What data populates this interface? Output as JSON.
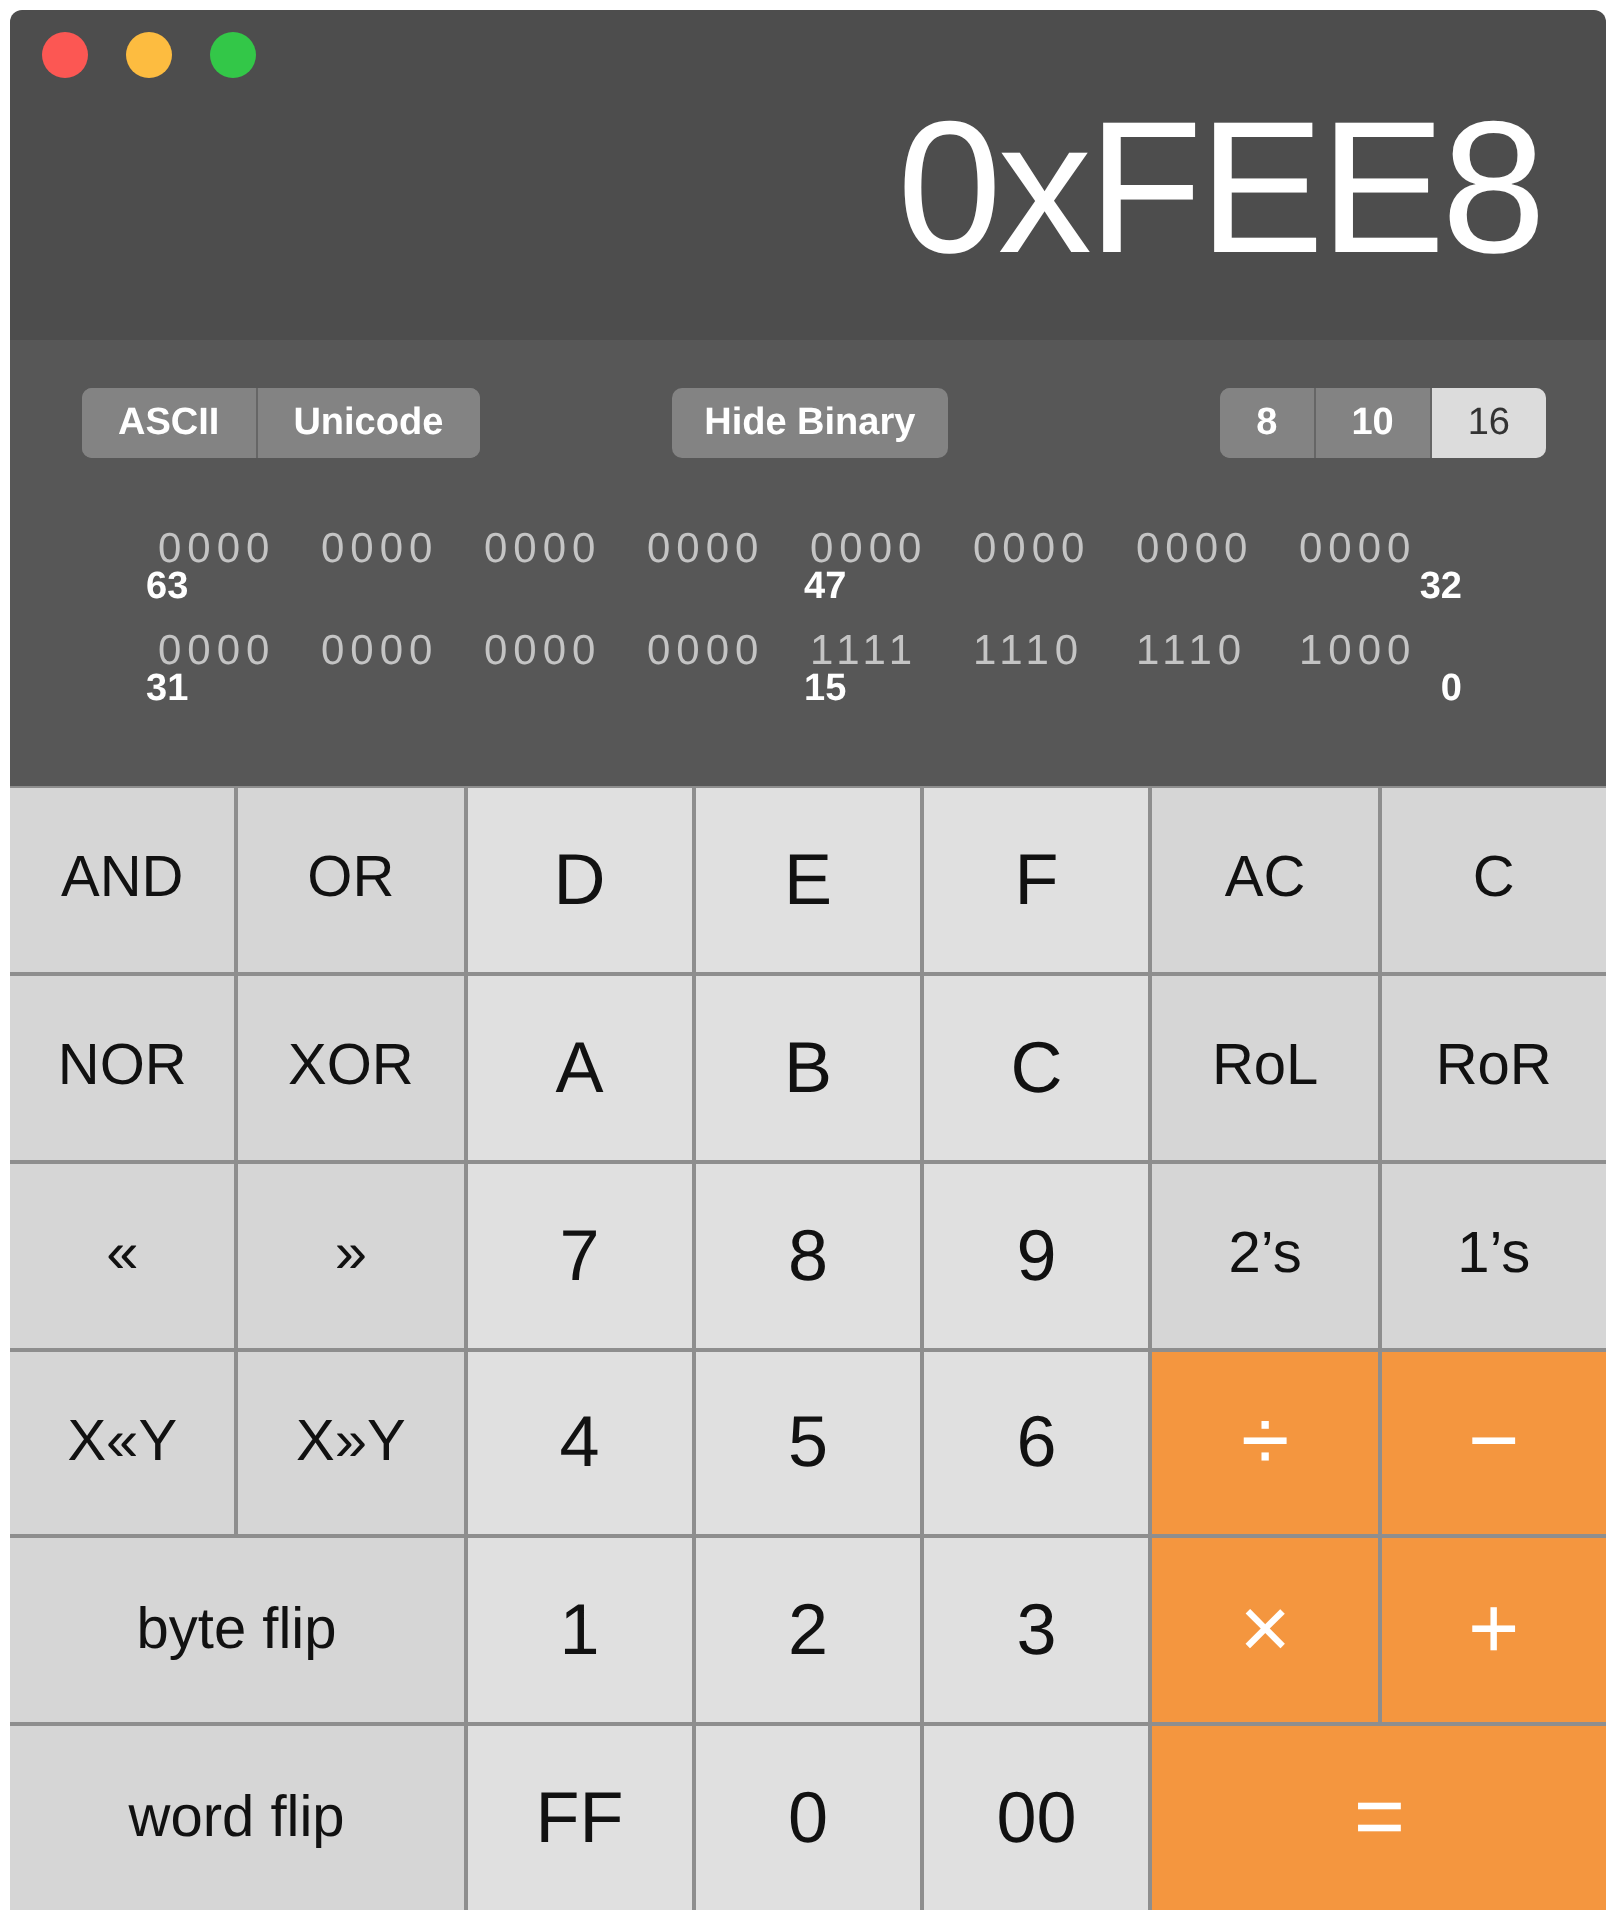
{
  "window": {
    "controls": [
      {
        "color": "#fc5753"
      },
      {
        "color": "#fdbc40"
      },
      {
        "color": "#33c748"
      }
    ]
  },
  "display": "0xFEE8",
  "encoding": [
    {
      "label": "ASCII",
      "selected": false
    },
    {
      "label": "Unicode",
      "selected": false
    }
  ],
  "hide_binary": "Hide Binary",
  "base": [
    {
      "label": "8",
      "selected": false
    },
    {
      "label": "10",
      "selected": false
    },
    {
      "label": "16",
      "selected": true
    }
  ],
  "binary": [
    {
      "bits": [
        "0000",
        "0000",
        "0000",
        "0000",
        "0000",
        "0000",
        "0000",
        "0000"
      ],
      "labels": [
        "63",
        "47",
        "32"
      ]
    },
    {
      "bits": [
        "0000",
        "0000",
        "0000",
        "0000",
        "1111",
        "1110",
        "1110",
        "1000"
      ],
      "labels": [
        "31",
        "15",
        "0"
      ]
    }
  ],
  "keys": [
    {
      "label": "AND",
      "kind": "func",
      "wide": false
    },
    {
      "label": "OR",
      "kind": "func",
      "wide": false
    },
    {
      "label": "D",
      "kind": "digit",
      "wide": false
    },
    {
      "label": "E",
      "kind": "digit",
      "wide": false
    },
    {
      "label": "F",
      "kind": "digit",
      "wide": false
    },
    {
      "label": "AC",
      "kind": "func",
      "wide": false
    },
    {
      "label": "C",
      "kind": "func",
      "wide": false
    },
    {
      "label": "NOR",
      "kind": "func",
      "wide": false
    },
    {
      "label": "XOR",
      "kind": "func",
      "wide": false
    },
    {
      "label": "A",
      "kind": "digit",
      "wide": false
    },
    {
      "label": "B",
      "kind": "digit",
      "wide": false
    },
    {
      "label": "C",
      "kind": "digit",
      "wide": false
    },
    {
      "label": "RoL",
      "kind": "func",
      "wide": false
    },
    {
      "label": "RoR",
      "kind": "func",
      "wide": false
    },
    {
      "label": "«",
      "kind": "func",
      "wide": false
    },
    {
      "label": "»",
      "kind": "func",
      "wide": false
    },
    {
      "label": "7",
      "kind": "digit",
      "wide": false
    },
    {
      "label": "8",
      "kind": "digit",
      "wide": false
    },
    {
      "label": "9",
      "kind": "digit",
      "wide": false
    },
    {
      "label": "2’s",
      "kind": "func",
      "wide": false
    },
    {
      "label": "1’s",
      "kind": "func",
      "wide": false
    },
    {
      "label": "X«Y",
      "kind": "func",
      "wide": false
    },
    {
      "label": "X»Y",
      "kind": "func",
      "wide": false
    },
    {
      "label": "4",
      "kind": "digit",
      "wide": false
    },
    {
      "label": "5",
      "kind": "digit",
      "wide": false
    },
    {
      "label": "6",
      "kind": "digit",
      "wide": false
    },
    {
      "label": "÷",
      "kind": "op",
      "wide": false
    },
    {
      "label": "−",
      "kind": "op",
      "wide": false
    },
    {
      "label": "byte flip",
      "kind": "func",
      "wide": true
    },
    {
      "label": "1",
      "kind": "digit",
      "wide": false
    },
    {
      "label": "2",
      "kind": "digit",
      "wide": false
    },
    {
      "label": "3",
      "kind": "digit",
      "wide": false
    },
    {
      "label": "×",
      "kind": "op",
      "wide": false
    },
    {
      "label": "+",
      "kind": "op",
      "wide": false
    },
    {
      "label": "word flip",
      "kind": "func",
      "wide": true
    },
    {
      "label": "FF",
      "kind": "digit",
      "wide": false
    },
    {
      "label": "0",
      "kind": "digit",
      "wide": false
    },
    {
      "label": "00",
      "kind": "digit",
      "wide": false
    },
    {
      "label": "=",
      "kind": "op",
      "wide": true
    }
  ]
}
